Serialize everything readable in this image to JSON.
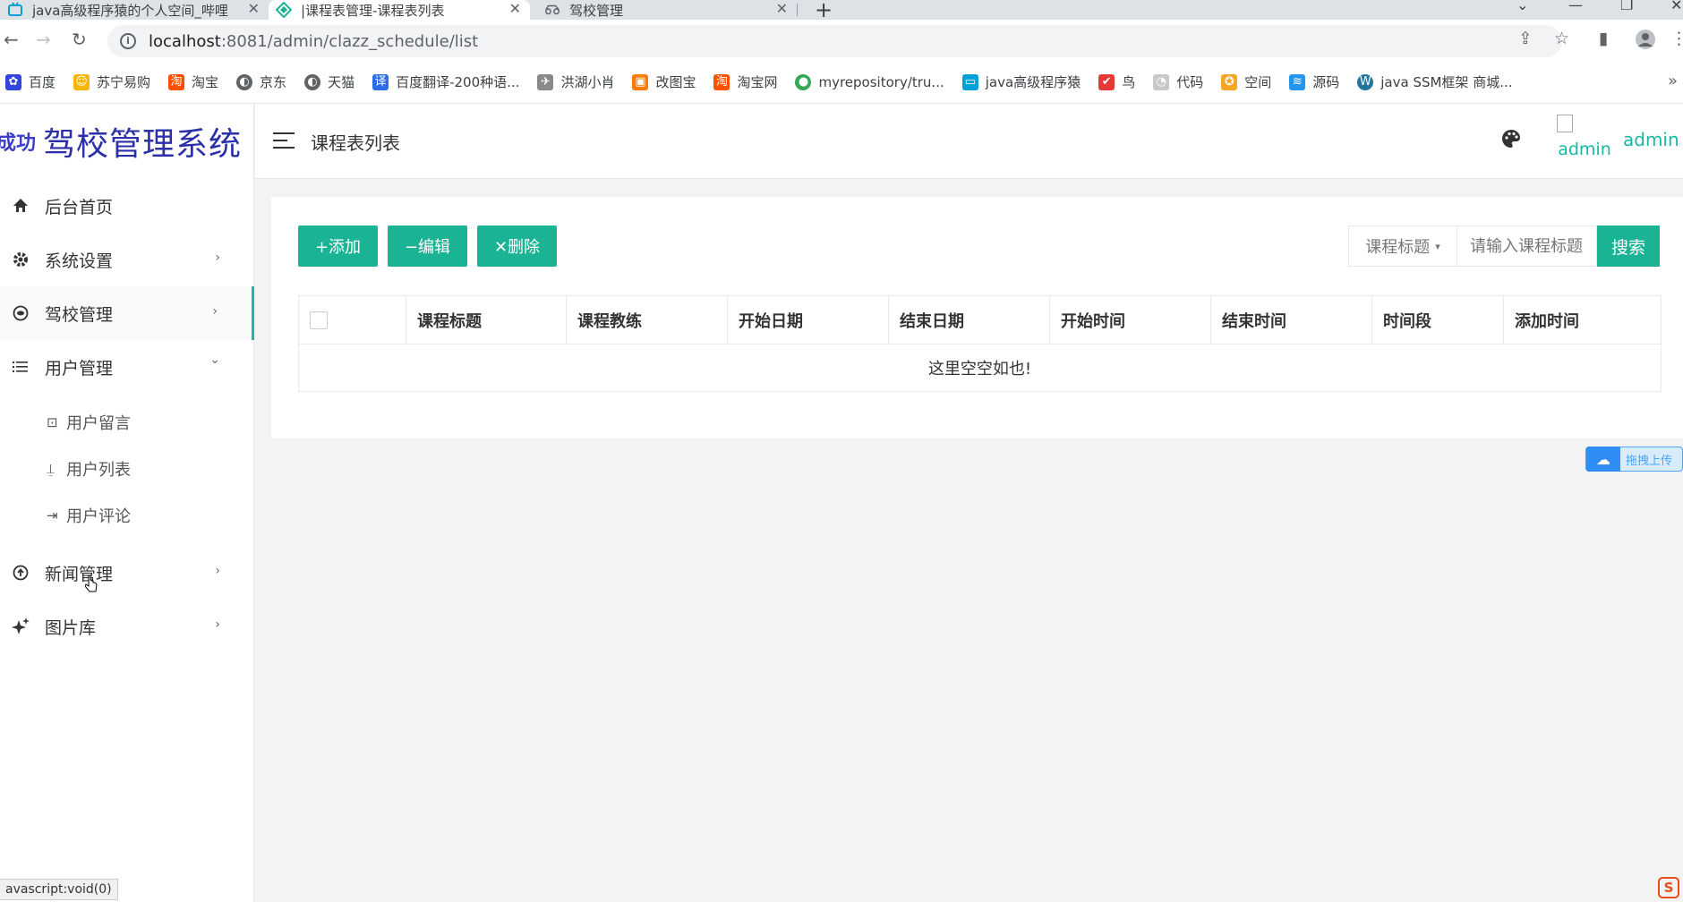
{
  "browser": {
    "tabs": [
      {
        "title": "java高级程序猿的个人空间_哔哩",
        "icon": "bilibili-icon",
        "close": "✕"
      },
      {
        "title": "|课程表管理-课程表列表",
        "icon": "app-icon",
        "close": "✕"
      },
      {
        "title": "驾校管理",
        "icon": "car-icon",
        "close": "✕"
      }
    ],
    "new_tab": "+",
    "address": {
      "host": "localhost",
      "path": ":8081/admin/clazz_schedule/list"
    },
    "bookmarks": [
      {
        "label": "百度",
        "icon": "baidu-icon",
        "color": "#3245df"
      },
      {
        "label": "苏宁易购",
        "icon": "suning-icon",
        "color": "#f7b500"
      },
      {
        "label": "淘宝",
        "icon": "taobao-icon",
        "color": "#ff5000"
      },
      {
        "label": "京东",
        "icon": "globe-icon",
        "color": "#5f6368"
      },
      {
        "label": "天猫",
        "icon": "globe-icon",
        "color": "#5f6368"
      },
      {
        "label": "百度翻译-200种语...",
        "icon": "translate-icon",
        "color": "#2b6de8"
      },
      {
        "label": "洪湖小肖",
        "icon": "bird-icon",
        "color": "#8a8a8a"
      },
      {
        "label": "改图宝",
        "icon": "gaitubao-icon",
        "color": "#ff7a00"
      },
      {
        "label": "淘宝网",
        "icon": "taobao-icon",
        "color": "#ff5000"
      },
      {
        "label": "myrepository/tru...",
        "icon": "chrome-icon",
        "color": "#34a853"
      },
      {
        "label": "java高级程序猿",
        "icon": "bilibili-icon",
        "color": "#00a1d6"
      },
      {
        "label": "鸟",
        "icon": "bird-icon",
        "color": "#e53935"
      },
      {
        "label": "代码",
        "icon": "code-icon",
        "color": "#c9c9c9"
      },
      {
        "label": "空间",
        "icon": "qzone-icon",
        "color": "#f5a623"
      },
      {
        "label": "源码",
        "icon": "docker-icon",
        "color": "#2496ed"
      },
      {
        "label": "java SSM框架 商城...",
        "icon": "wordpress-icon",
        "color": "#21759b"
      }
    ],
    "bookmarks_more": "»"
  },
  "app": {
    "brand_logo": "成功",
    "brand_title": "驾校管理系统",
    "page_title": "课程表列表",
    "user": {
      "avatar_alt": "admin",
      "name": "admin"
    },
    "menu": [
      {
        "label": "后台首页",
        "icon": "home-icon",
        "arrow": ""
      },
      {
        "label": "系统设置",
        "icon": "gear-icon",
        "arrow": "›"
      },
      {
        "label": "驾校管理",
        "icon": "target-icon",
        "arrow": "›"
      },
      {
        "label": "用户管理",
        "icon": "list-icon",
        "arrow": "⌄"
      },
      {
        "label": "新闻管理",
        "icon": "upload-circle-icon",
        "arrow": "›"
      },
      {
        "label": "图片库",
        "icon": "sparkle-icon",
        "arrow": "›"
      }
    ],
    "submenu": [
      {
        "label": "用户留言",
        "icon": "message-icon"
      },
      {
        "label": "用户列表",
        "icon": "user-icon"
      },
      {
        "label": "用户评论",
        "icon": "comment-icon"
      }
    ],
    "actions": {
      "add": "+添加",
      "edit": "−编辑",
      "delete": "✕删除"
    },
    "search": {
      "field": "课程标题",
      "placeholder": "请输入课程标题",
      "button": "搜索"
    },
    "table": {
      "columns": [
        "课程标题",
        "课程教练",
        "开始日期",
        "结束日期",
        "开始时间",
        "结束时间",
        "时间段",
        "添加时间"
      ],
      "empty_text": "这里空空如也!"
    },
    "upload_widget": "拖拽上传",
    "status_tip": "avascript:void(0)",
    "corner_logo": "S"
  },
  "colors": {
    "accent": "#1ab394",
    "brand": "#2b2fa8",
    "user": "#18b9a3"
  }
}
